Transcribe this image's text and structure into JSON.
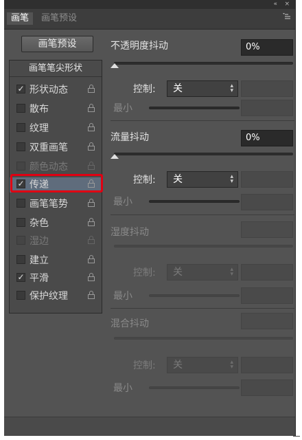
{
  "window": {
    "collapse_glyph": "«",
    "close_glyph": "×"
  },
  "tabs": [
    {
      "label": "画笔",
      "active": true
    },
    {
      "label": "画笔预设",
      "active": false
    }
  ],
  "tab_menu_icon": "panel-menu-icon",
  "preset_button": "画笔预设",
  "left_panel": {
    "header": "画笔笔尖形状",
    "items": [
      {
        "label": "形状动态",
        "checked": true,
        "enabled": true
      },
      {
        "label": "散布",
        "checked": false,
        "enabled": true
      },
      {
        "label": "纹理",
        "checked": false,
        "enabled": true
      },
      {
        "label": "双重画笔",
        "checked": false,
        "enabled": true
      },
      {
        "label": "颜色动态",
        "checked": false,
        "enabled": false
      },
      {
        "label": "传递",
        "checked": true,
        "enabled": true,
        "selected": true
      },
      {
        "label": "画笔笔势",
        "checked": false,
        "enabled": true
      },
      {
        "label": "杂色",
        "checked": false,
        "enabled": true
      },
      {
        "label": "湿边",
        "checked": false,
        "enabled": false
      },
      {
        "label": "建立",
        "checked": false,
        "enabled": true
      },
      {
        "label": "平滑",
        "checked": true,
        "enabled": true
      },
      {
        "label": "保护纹理",
        "checked": false,
        "enabled": true
      }
    ]
  },
  "sections": [
    {
      "title": "不透明度抖动",
      "value": "0%",
      "enabled": true,
      "slider_level": 0,
      "control_label": "控制:",
      "control_value": "关",
      "min_label": "最小"
    },
    {
      "title": "流量抖动",
      "value": "0%",
      "enabled": true,
      "slider_level": 0,
      "control_label": "控制:",
      "control_value": "关",
      "min_label": "最小"
    },
    {
      "title": "湿度抖动",
      "value": "",
      "enabled": false,
      "control_label": "控制:",
      "control_value": "关",
      "min_label": "最小"
    },
    {
      "title": "混合抖动",
      "value": "",
      "enabled": false,
      "control_label": "控制:",
      "control_value": "关",
      "min_label": "最小"
    }
  ],
  "checkmark_glyph": "✓",
  "select_arrows": "▴▾",
  "highlight_color": "#e00012",
  "panel_bg": "#535353"
}
